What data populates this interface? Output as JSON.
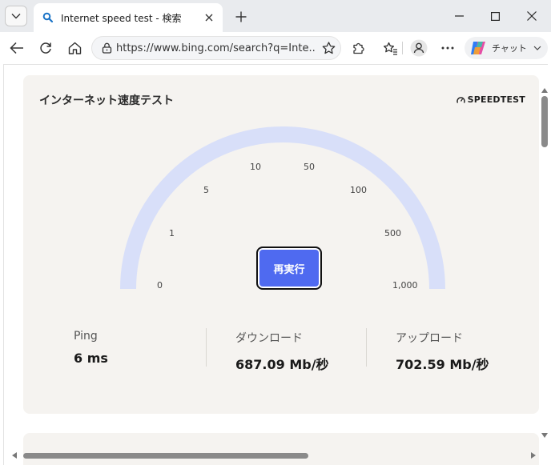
{
  "browser": {
    "tab": {
      "title": "Internet speed test - 検索",
      "favicon": "search-icon"
    },
    "address_bar": {
      "url": "https://www.bing.com/search?q=Inte..."
    },
    "copilot": {
      "label": "チャット"
    }
  },
  "speedtest": {
    "title": "インターネット速度テスト",
    "brand": "SPEEDTEST",
    "gauge": {
      "tick_labels": [
        "0",
        "1",
        "5",
        "10",
        "50",
        "100",
        "500",
        "1,000"
      ],
      "track_color": "#d8dff9"
    },
    "rerun_label": "再実行",
    "accent_color": "#4f6af0",
    "stats": {
      "ping": {
        "label": "Ping",
        "value": "6 ms"
      },
      "download": {
        "label": "ダウンロード",
        "value": "687.09 Mb/秒"
      },
      "upload": {
        "label": "アップロード",
        "value": "702.59 Mb/秒"
      }
    }
  }
}
